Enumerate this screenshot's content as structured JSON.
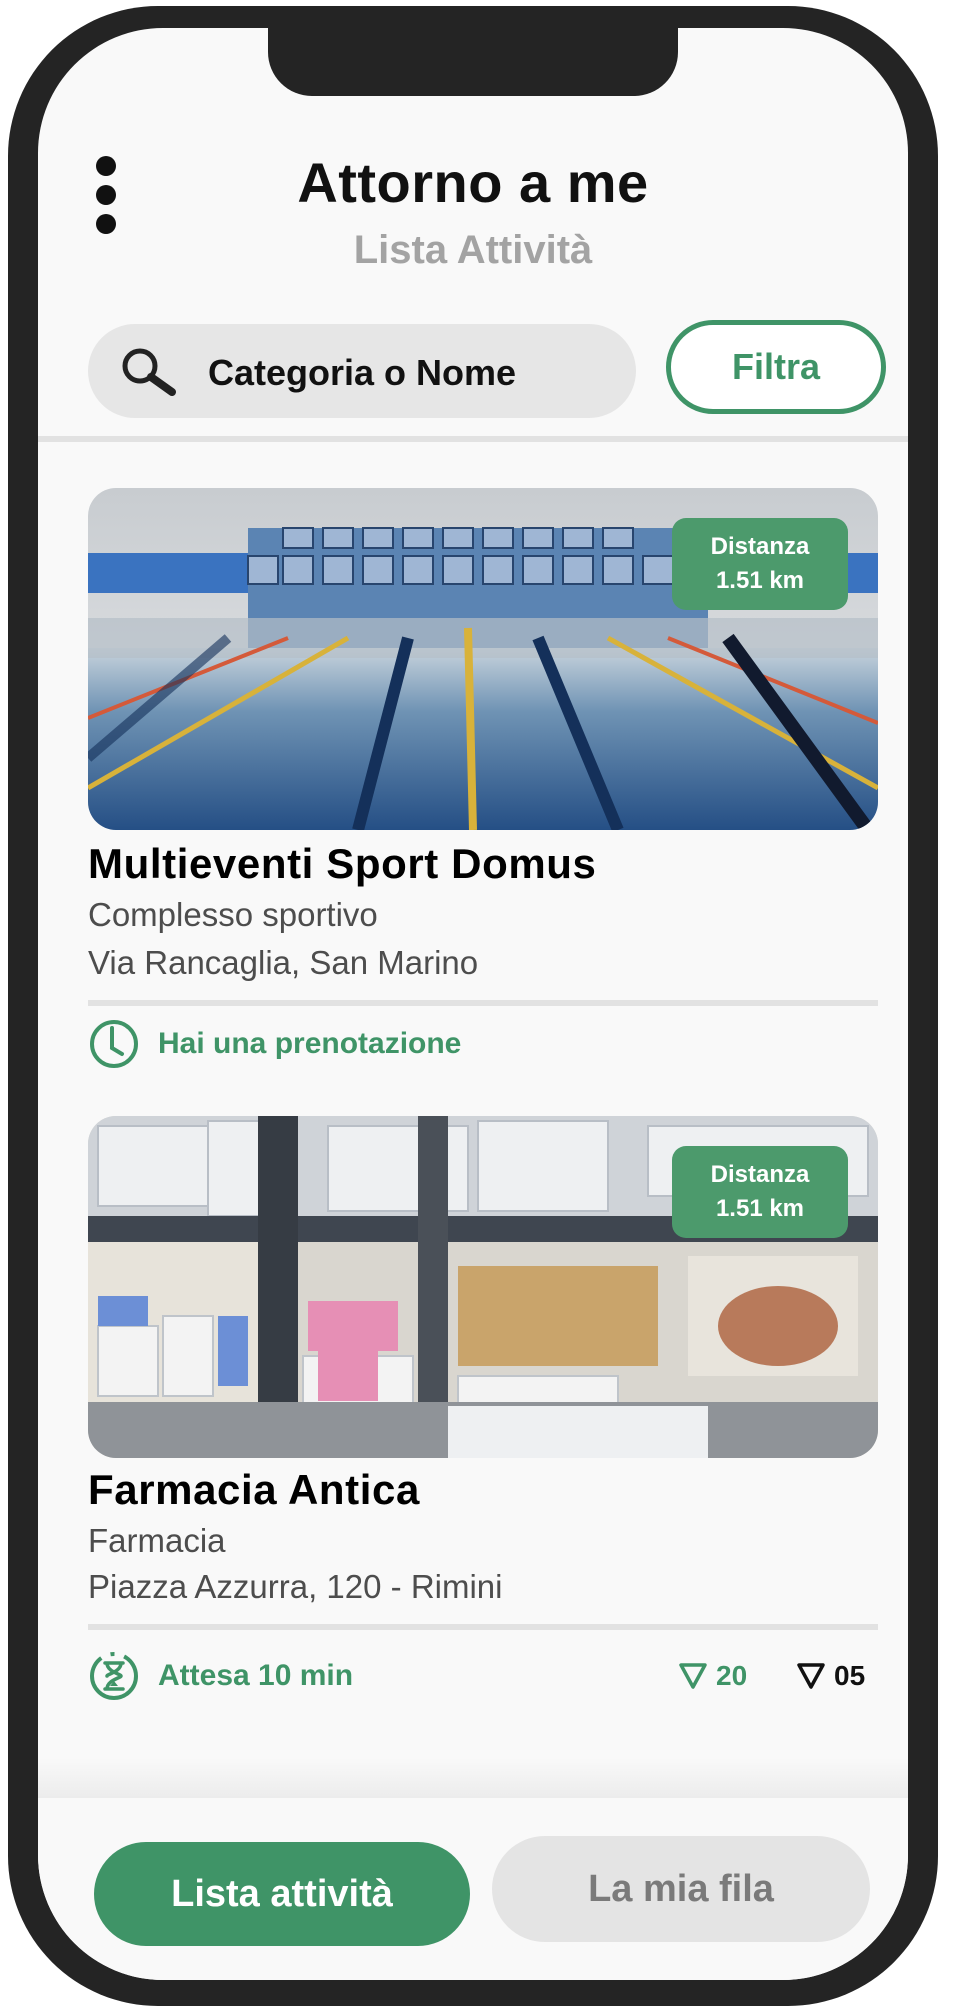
{
  "header": {
    "title": "Attorno a me",
    "subtitle": "Lista Attività",
    "menu_icon": "more-vertical-icon"
  },
  "search": {
    "placeholder": "Categoria o Nome",
    "icon": "search-icon"
  },
  "filter": {
    "label": "Filtra"
  },
  "colors": {
    "accent": "#3f9467",
    "badge": "#4c9a6c",
    "muted_text": "#a3a3a3",
    "inactive_button": "#e4e4e4"
  },
  "cards": [
    {
      "name": "Multieventi Sport Domus",
      "category": "Complesso sportivo",
      "address": "Via Rancaglia, San Marino",
      "distance_label": "Distanza",
      "distance_value": "1.51 km",
      "status_icon": "clock-icon",
      "status_text": "Hai una prenotazione"
    },
    {
      "name": "Farmacia Antica",
      "category": "Farmacia",
      "address": "Piazza Azzurra, 120 - Rimini",
      "distance_label": "Distanza",
      "distance_value": "1.51 km",
      "status_icon": "hourglass-icon",
      "status_text": "Attesa 10 min",
      "counters": [
        {
          "value": "20",
          "icon": "triangle-down-icon",
          "color": "#3f9467"
        },
        {
          "value": "05",
          "icon": "triangle-down-icon",
          "color": "#111111"
        }
      ]
    }
  ],
  "bottom_nav": {
    "list_label": "Lista attività",
    "queue_label": "La mia fila"
  }
}
